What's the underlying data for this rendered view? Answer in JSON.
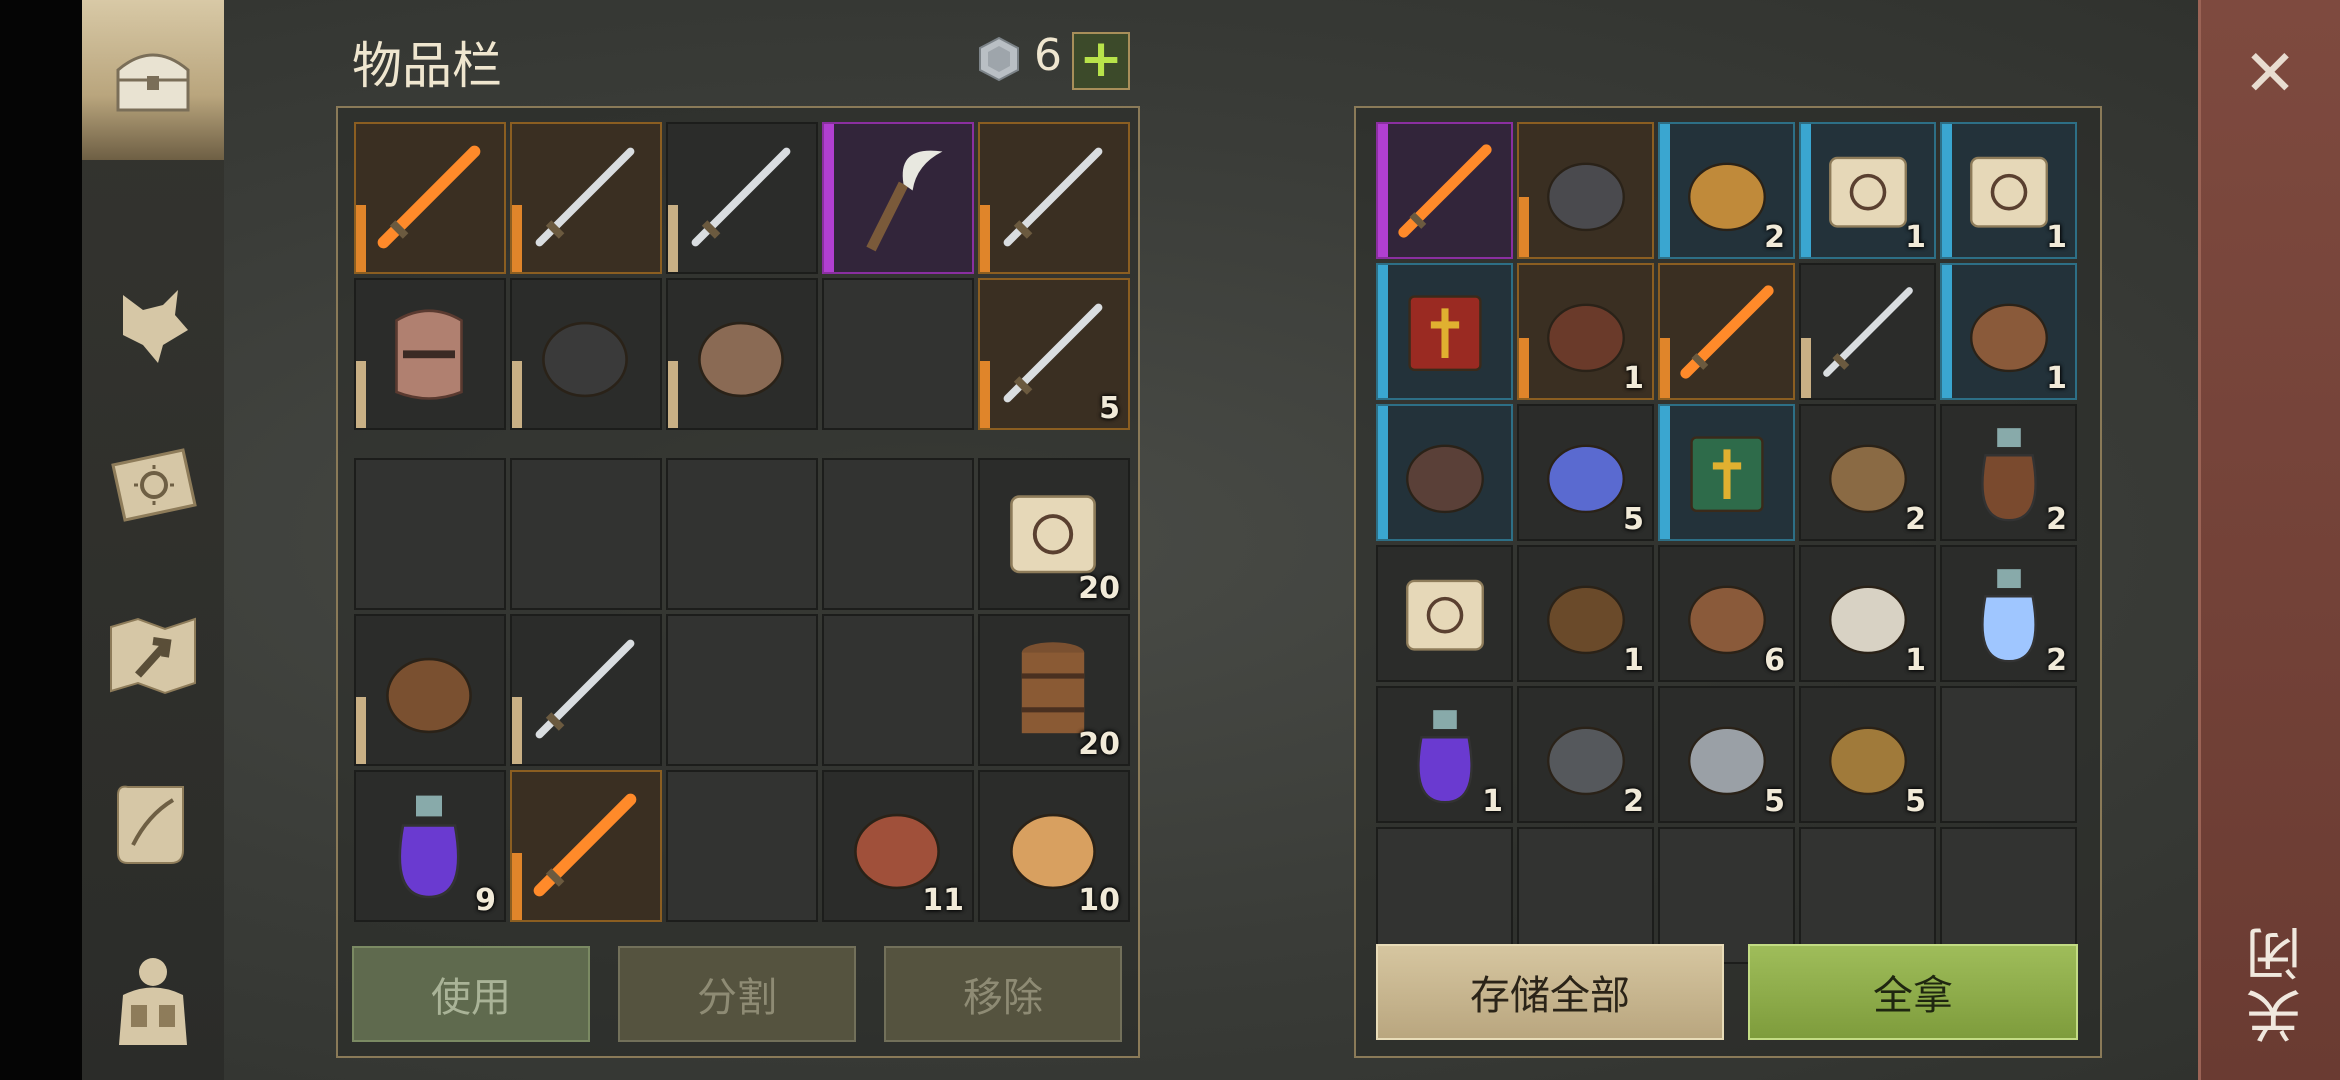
{
  "header": {
    "title": "物品栏",
    "coin_count": "6",
    "plus_label": "+"
  },
  "sidebar": {
    "items": [
      {
        "name": "chest-icon",
        "active": true
      },
      {
        "name": "wolf-icon",
        "active": false
      },
      {
        "name": "sun-book-icon",
        "active": false
      },
      {
        "name": "map-icon",
        "active": false
      },
      {
        "name": "quill-scroll-icon",
        "active": false
      },
      {
        "name": "backpack-icon",
        "active": false
      }
    ]
  },
  "equipment": [
    {
      "icon": "flaming-sword-icon",
      "rarity": "orange",
      "count": ""
    },
    {
      "icon": "wavy-dagger-icon",
      "rarity": "orange",
      "count": ""
    },
    {
      "icon": "long-sword-icon",
      "rarity": "tan",
      "count": ""
    },
    {
      "icon": "scythe-icon",
      "rarity": "purple",
      "count": ""
    },
    {
      "icon": "mace-spear-icon",
      "rarity": "orange",
      "count": ""
    },
    {
      "icon": "knight-helmet-icon",
      "rarity": "tan",
      "count": ""
    },
    {
      "icon": "leg-armor-icon",
      "rarity": "tan",
      "count": ""
    },
    {
      "icon": "chainmail-icon",
      "rarity": "tan",
      "count": ""
    },
    {
      "icon": "",
      "rarity": "empty",
      "count": ""
    },
    {
      "icon": "halberd-icon",
      "rarity": "orange",
      "count": "5"
    }
  ],
  "backpack": [
    {
      "icon": "",
      "rarity": "empty",
      "count": ""
    },
    {
      "icon": "",
      "rarity": "empty",
      "count": ""
    },
    {
      "icon": "",
      "rarity": "empty",
      "count": ""
    },
    {
      "icon": "",
      "rarity": "empty",
      "count": ""
    },
    {
      "icon": "skull-scroll-icon",
      "rarity": "none",
      "count": "20"
    },
    {
      "icon": "crossbow-icon",
      "rarity": "tan",
      "count": ""
    },
    {
      "icon": "scimitar-icon",
      "rarity": "tan",
      "count": ""
    },
    {
      "icon": "",
      "rarity": "empty",
      "count": ""
    },
    {
      "icon": "",
      "rarity": "empty",
      "count": ""
    },
    {
      "icon": "barrel-icon",
      "rarity": "none",
      "count": "20"
    },
    {
      "icon": "purple-potion-icon",
      "rarity": "none",
      "count": "9"
    },
    {
      "icon": "flaming-sword-icon",
      "rarity": "orange",
      "count": ""
    },
    {
      "icon": "",
      "rarity": "empty",
      "count": ""
    },
    {
      "icon": "bacon-icon",
      "rarity": "none",
      "count": "11"
    },
    {
      "icon": "berry-bowl-icon",
      "rarity": "none",
      "count": "10"
    }
  ],
  "storage": [
    {
      "icon": "flaming-axe-icon",
      "rarity": "purple",
      "count": ""
    },
    {
      "icon": "boots-icon",
      "rarity": "orange",
      "count": ""
    },
    {
      "icon": "bell-icon",
      "rarity": "blue",
      "count": "2"
    },
    {
      "icon": "blue-rune-scroll-icon",
      "rarity": "blue",
      "count": "1"
    },
    {
      "icon": "purple-rune-scroll-icon",
      "rarity": "blue",
      "count": "1"
    },
    {
      "icon": "red-book-icon",
      "rarity": "blue",
      "count": ""
    },
    {
      "icon": "harness-icon",
      "rarity": "orange",
      "count": "1"
    },
    {
      "icon": "flaming-sword-icon",
      "rarity": "orange",
      "count": ""
    },
    {
      "icon": "long-sword-icon",
      "rarity": "tan",
      "count": ""
    },
    {
      "icon": "collar-icon",
      "rarity": "blue",
      "count": "1"
    },
    {
      "icon": "gauntlet-icon",
      "rarity": "blue",
      "count": ""
    },
    {
      "icon": "crystal-icon",
      "rarity": "none",
      "count": "5"
    },
    {
      "icon": "green-book-icon",
      "rarity": "blue",
      "count": ""
    },
    {
      "icon": "rope-icon",
      "rarity": "none",
      "count": "2"
    },
    {
      "icon": "flask-icon",
      "rarity": "none",
      "count": "2"
    },
    {
      "icon": "paper-stack-icon",
      "rarity": "none",
      "count": ""
    },
    {
      "icon": "bear-trap-icon",
      "rarity": "none",
      "count": "1"
    },
    {
      "icon": "grain-sack-icon",
      "rarity": "none",
      "count": "6"
    },
    {
      "icon": "skull-icon",
      "rarity": "none",
      "count": "1"
    },
    {
      "icon": "blue-potion-icon",
      "rarity": "none",
      "count": "2"
    },
    {
      "icon": "purple-potion-icon",
      "rarity": "none",
      "count": "1"
    },
    {
      "icon": "gear-icon",
      "rarity": "none",
      "count": "2"
    },
    {
      "icon": "ore-icon",
      "rarity": "none",
      "count": "5"
    },
    {
      "icon": "ingot-icon",
      "rarity": "none",
      "count": "5"
    },
    {
      "icon": "",
      "rarity": "empty",
      "count": ""
    },
    {
      "icon": "",
      "rarity": "empty",
      "count": ""
    },
    {
      "icon": "",
      "rarity": "empty",
      "count": ""
    },
    {
      "icon": "",
      "rarity": "empty",
      "count": ""
    },
    {
      "icon": "",
      "rarity": "empty",
      "count": ""
    },
    {
      "icon": "",
      "rarity": "empty",
      "count": ""
    }
  ],
  "buttons": {
    "use": "使用",
    "split": "分割",
    "remove": "移除",
    "store_all": "存储全部",
    "take_all": "全拿"
  },
  "close": {
    "label": "关闭",
    "x": "✕"
  },
  "colors": {
    "orange": "#e0852a",
    "purple": "#b13fd1",
    "blue": "#3aa6d0",
    "tan": "#c9b085"
  }
}
